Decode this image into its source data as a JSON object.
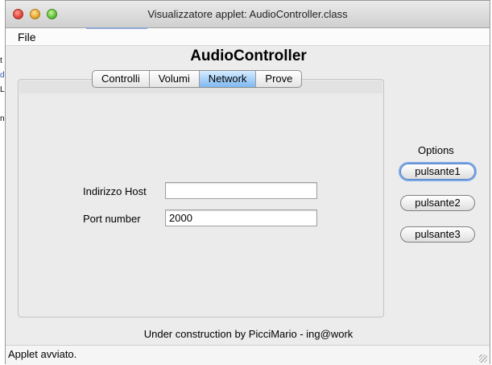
{
  "window": {
    "title": "Visualizzatore applet: AudioController.class"
  },
  "menu": {
    "file_label": "File"
  },
  "app": {
    "title": "AudioController"
  },
  "tabs": [
    {
      "label": "Controlli",
      "active": false
    },
    {
      "label": "Volumi",
      "active": false
    },
    {
      "label": "Network",
      "active": true
    },
    {
      "label": "Prove",
      "active": false
    }
  ],
  "network": {
    "host_label": "Indirizzo Host",
    "host_value": "",
    "port_label": "Port number",
    "port_value": "2000"
  },
  "options": {
    "title": "Options",
    "buttons": [
      "pulsante1",
      "pulsante2",
      "pulsante3"
    ]
  },
  "footer": {
    "credit": "Under construction by PicciMario - ing@work"
  },
  "status": {
    "text": "Applet avviato."
  },
  "background": {
    "left_chars": [
      "t",
      "d",
      "Li",
      "n"
    ],
    "bottom_number": "86"
  },
  "colors": {
    "active_tab": "#7fb9f2",
    "focus_ring": "#7aa7e6",
    "window_bg": "#ececec"
  }
}
